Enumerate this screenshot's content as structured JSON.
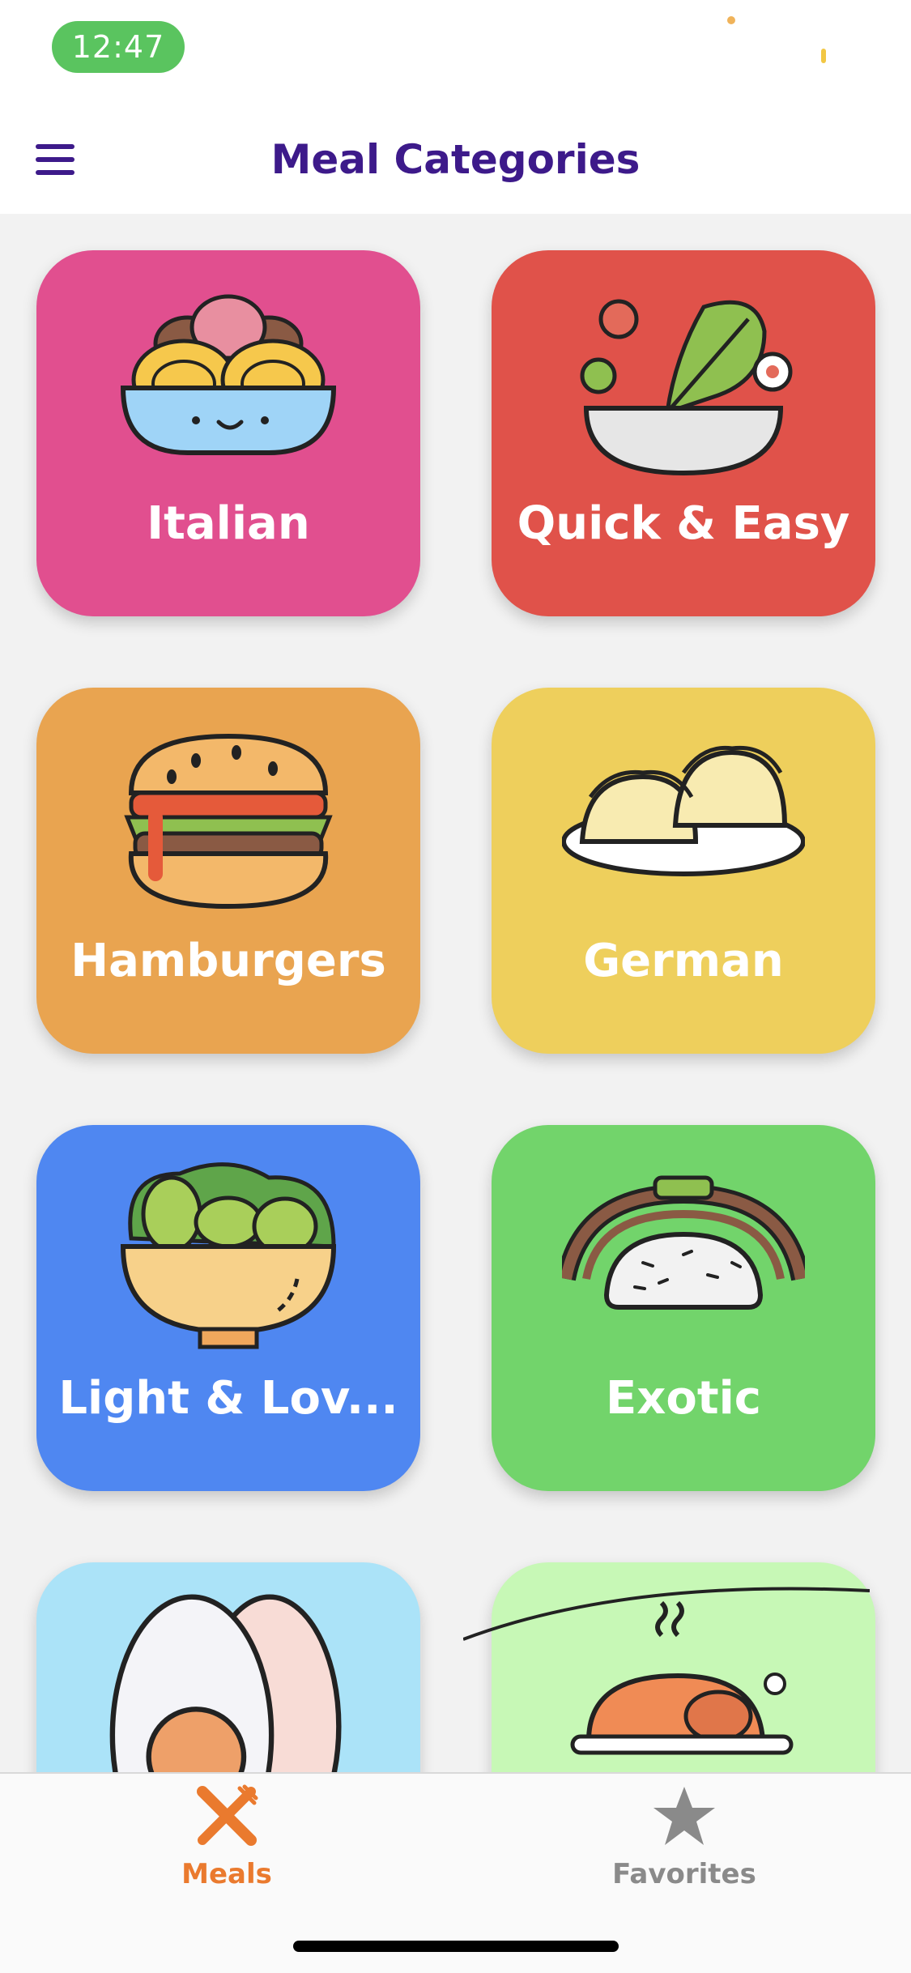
{
  "status": {
    "time": "12:47"
  },
  "header": {
    "title": "Meal Categories",
    "menu_icon": "hamburger-menu-icon"
  },
  "categories": [
    {
      "label": "Italian",
      "color": "#e14f8f",
      "icon": "spaghetti-bowl-icon"
    },
    {
      "label": "Quick & Easy",
      "color": "#e0524a",
      "icon": "salad-bowl-icon"
    },
    {
      "label": "Hamburgers",
      "color": "#e9a450",
      "icon": "hamburger-icon"
    },
    {
      "label": "German",
      "color": "#eecf5c",
      "icon": "dumplings-icon"
    },
    {
      "label": "Light & Lov...",
      "color": "#4f87f1",
      "icon": "leafy-salad-icon"
    },
    {
      "label": "Exotic",
      "color": "#72d46b",
      "icon": "rice-dish-icon"
    },
    {
      "label": "",
      "color": "#abe3f8",
      "icon": "boiled-egg-icon"
    },
    {
      "label": "",
      "color": "#c7f8b6",
      "icon": "roast-turkey-icon"
    }
  ],
  "tabbar": {
    "meals": {
      "label": "Meals",
      "icon": "fork-knife-icon",
      "color": "#ea7a2e",
      "active": true
    },
    "favorites": {
      "label": "Favorites",
      "icon": "star-icon",
      "color": "#8a8a8a",
      "active": false
    }
  }
}
